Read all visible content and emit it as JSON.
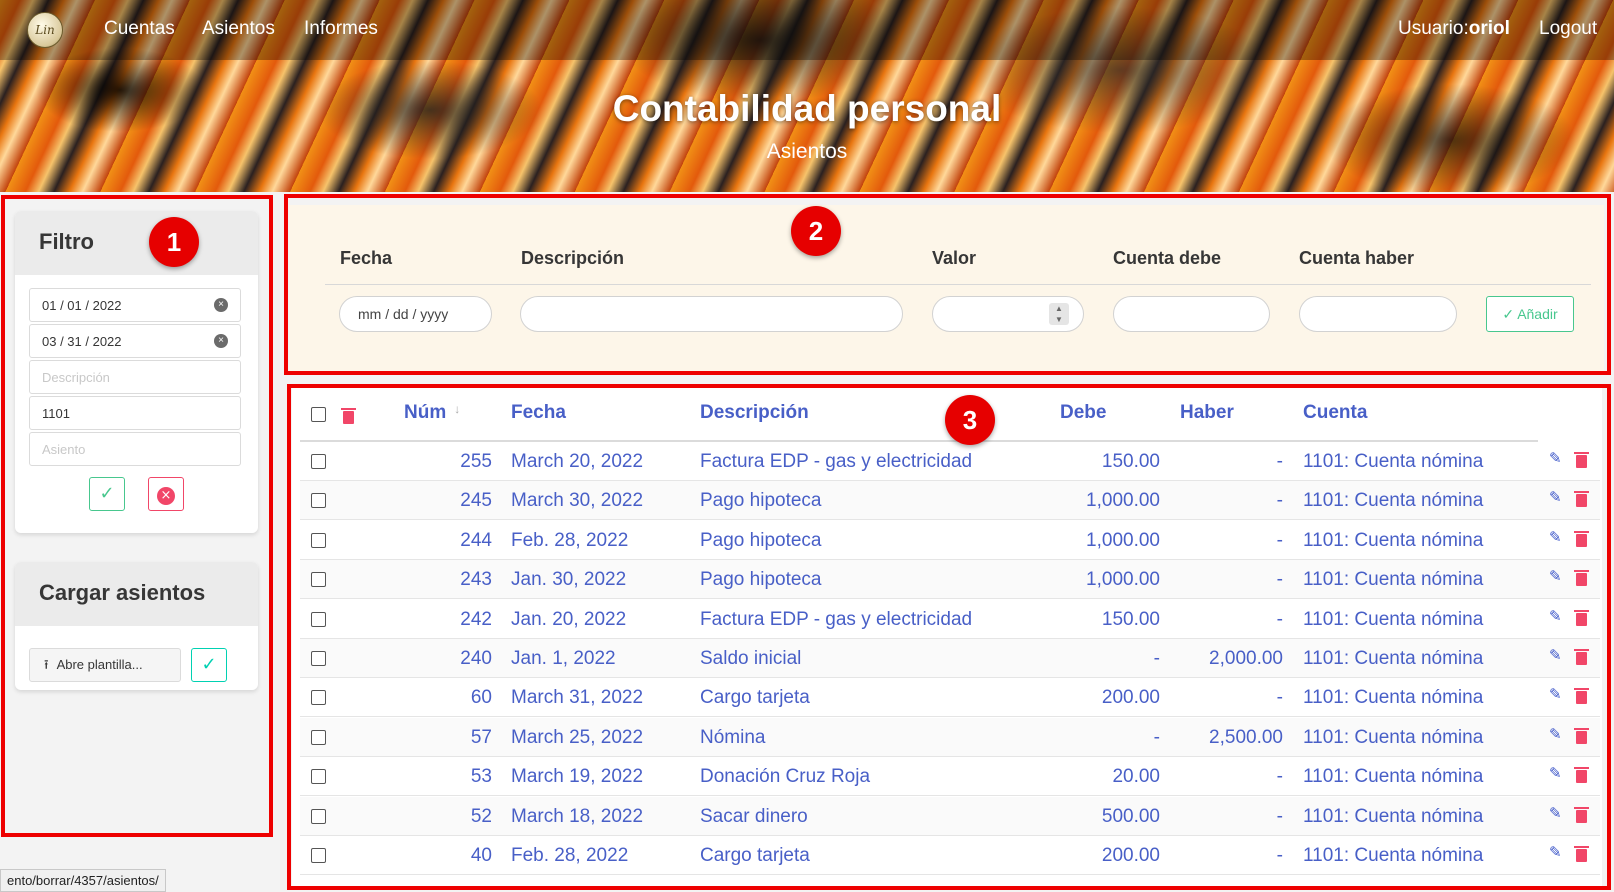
{
  "nav": {
    "logo_text": "Lin",
    "links": [
      "Cuentas",
      "Asientos",
      "Informes"
    ],
    "user_prefix": "Usuario:",
    "user_name": "oriol",
    "logout": "Logout"
  },
  "hero": {
    "title": "Contabilidad personal",
    "subtitle": "Asientos"
  },
  "badges": [
    "1",
    "2",
    "3"
  ],
  "filter": {
    "title": "Filtro",
    "date_from": "01 / 01 / 2022",
    "date_to": "03 / 31 / 2022",
    "description_placeholder": "Descripción",
    "account_value": "1101",
    "entry_placeholder": "Asiento"
  },
  "upload": {
    "title": "Cargar asientos",
    "button_label": "Abre plantilla..."
  },
  "add_form": {
    "labels": [
      "Fecha",
      "Descripción",
      "Valor",
      "Cuenta debe",
      "Cuenta haber"
    ],
    "date_placeholder": "mm / dd / yyyy",
    "add_button": "Añadir"
  },
  "table": {
    "headers": [
      "Núm",
      "Fecha",
      "Descripción",
      "Debe",
      "Haber",
      "Cuenta"
    ],
    "rows": [
      {
        "num": "255",
        "fecha": "March 20, 2022",
        "desc": "Factura EDP - gas y electricidad",
        "debe": "150.00",
        "haber": "-",
        "cuenta": "1101: Cuenta nómina"
      },
      {
        "num": "245",
        "fecha": "March 30, 2022",
        "desc": "Pago hipoteca",
        "debe": "1,000.00",
        "haber": "-",
        "cuenta": "1101: Cuenta nómina"
      },
      {
        "num": "244",
        "fecha": "Feb. 28, 2022",
        "desc": "Pago hipoteca",
        "debe": "1,000.00",
        "haber": "-",
        "cuenta": "1101: Cuenta nómina"
      },
      {
        "num": "243",
        "fecha": "Jan. 30, 2022",
        "desc": "Pago hipoteca",
        "debe": "1,000.00",
        "haber": "-",
        "cuenta": "1101: Cuenta nómina"
      },
      {
        "num": "242",
        "fecha": "Jan. 20, 2022",
        "desc": "Factura EDP - gas y electricidad",
        "debe": "150.00",
        "haber": "-",
        "cuenta": "1101: Cuenta nómina"
      },
      {
        "num": "240",
        "fecha": "Jan. 1, 2022",
        "desc": "Saldo inicial",
        "debe": "-",
        "haber": "2,000.00",
        "cuenta": "1101: Cuenta nómina"
      },
      {
        "num": "60",
        "fecha": "March 31, 2022",
        "desc": "Cargo tarjeta",
        "debe": "200.00",
        "haber": "-",
        "cuenta": "1101: Cuenta nómina"
      },
      {
        "num": "57",
        "fecha": "March 25, 2022",
        "desc": "Nómina",
        "debe": "-",
        "haber": "2,500.00",
        "cuenta": "1101: Cuenta nómina"
      },
      {
        "num": "53",
        "fecha": "March 19, 2022",
        "desc": "Donación Cruz Roja",
        "debe": "20.00",
        "haber": "-",
        "cuenta": "1101: Cuenta nómina"
      },
      {
        "num": "52",
        "fecha": "March 18, 2022",
        "desc": "Sacar dinero",
        "debe": "500.00",
        "haber": "-",
        "cuenta": "1101: Cuenta nómina"
      },
      {
        "num": "40",
        "fecha": "Feb. 28, 2022",
        "desc": "Cargo tarjeta",
        "debe": "200.00",
        "haber": "-",
        "cuenta": "1101: Cuenta nómina"
      }
    ]
  },
  "status_url": "ento/borrar/4357/asientos/",
  "colors": {
    "link": "#485fc7",
    "success": "#48c78e",
    "danger": "#f14668",
    "annotation": "#ee0000"
  }
}
